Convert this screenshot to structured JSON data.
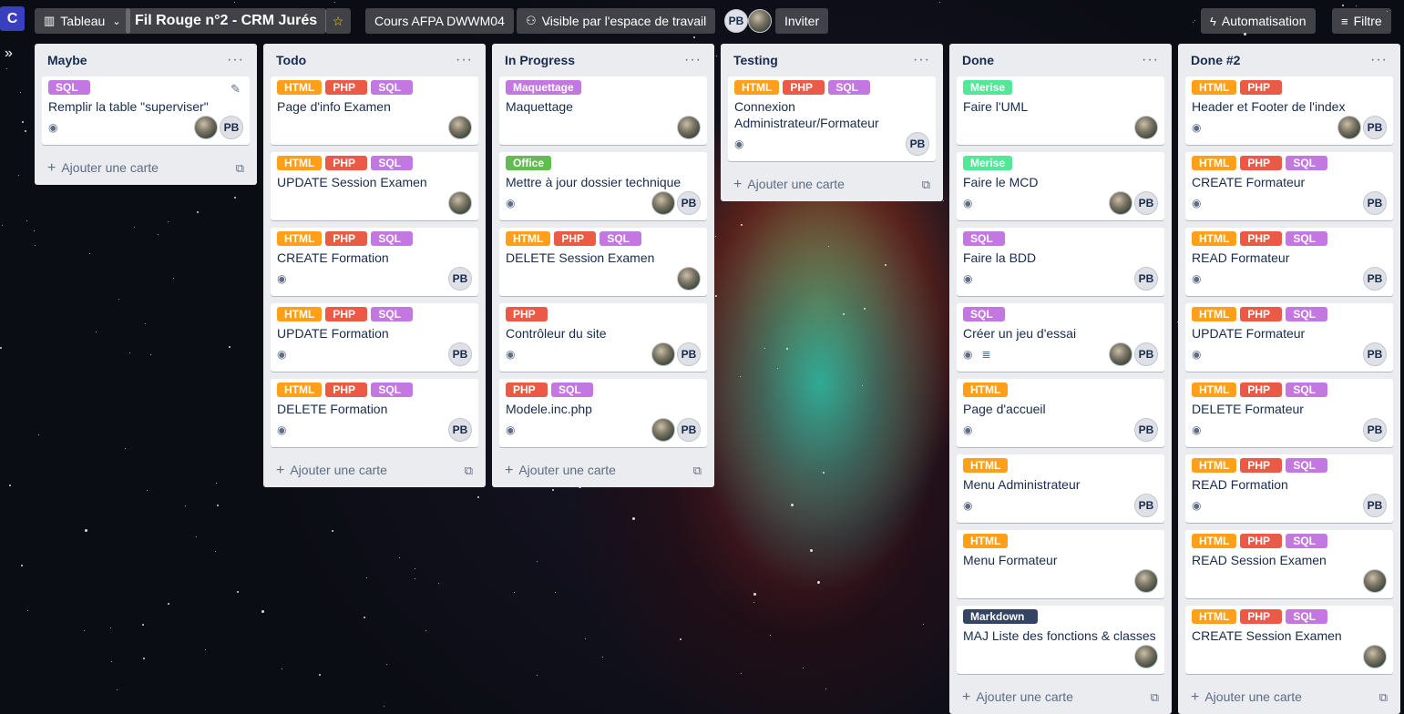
{
  "topbar": {
    "logo": "C",
    "view_label": "Tableau",
    "board_title": "Fil Rouge n°2 - CRM Jurés",
    "workspace": "Cours AFPA DWWM04",
    "visibility": "Visible par l'espace de travail",
    "member_initials": "PB",
    "invite": "Inviter",
    "automation": "Automatisation",
    "filter": "Filtre"
  },
  "colors": {
    "HTML": "#ff9f1a",
    "PHP": "#eb5a46",
    "SQL": "#c377e0",
    "Maquettage": "#c377e0",
    "Office": "#61bd4f",
    "Merise": "#51e898",
    "Markdown": "#344563"
  },
  "add_card_label": "Ajouter une carte",
  "lists": [
    {
      "title": "Maybe",
      "cards": [
        {
          "labels": [
            "SQL"
          ],
          "title": "Remplir la table \"superviser\"",
          "watch": true,
          "desc": false,
          "members": [
            "img",
            "PB"
          ],
          "edit": true
        }
      ]
    },
    {
      "title": "Todo",
      "cards": [
        {
          "labels": [
            "HTML",
            "PHP",
            "SQL"
          ],
          "title": "Page d'info Examen",
          "watch": false,
          "desc": false,
          "members": [
            "img"
          ]
        },
        {
          "labels": [
            "HTML",
            "PHP",
            "SQL"
          ],
          "title": "UPDATE Session Examen",
          "watch": false,
          "desc": false,
          "members": [
            "img"
          ]
        },
        {
          "labels": [
            "HTML",
            "PHP",
            "SQL"
          ],
          "title": "CREATE Formation",
          "watch": true,
          "desc": false,
          "members": [
            "PB"
          ]
        },
        {
          "labels": [
            "HTML",
            "PHP",
            "SQL"
          ],
          "title": "UPDATE Formation",
          "watch": true,
          "desc": false,
          "members": [
            "PB"
          ]
        },
        {
          "labels": [
            "HTML",
            "PHP",
            "SQL"
          ],
          "title": "DELETE Formation",
          "watch": true,
          "desc": false,
          "members": [
            "PB"
          ]
        }
      ]
    },
    {
      "title": "In Progress",
      "cards": [
        {
          "labels": [
            "Maquettage"
          ],
          "title": "Maquettage",
          "watch": false,
          "desc": false,
          "members": [
            "img"
          ]
        },
        {
          "labels": [
            "Office"
          ],
          "title": "Mettre à jour dossier technique",
          "watch": true,
          "desc": false,
          "members": [
            "img",
            "PB"
          ]
        },
        {
          "labels": [
            "HTML",
            "PHP",
            "SQL"
          ],
          "title": "DELETE Session Examen",
          "watch": false,
          "desc": false,
          "members": [
            "img"
          ]
        },
        {
          "labels": [
            "PHP"
          ],
          "title": "Contrôleur du site",
          "watch": true,
          "desc": false,
          "members": [
            "img",
            "PB"
          ]
        },
        {
          "labels": [
            "PHP",
            "SQL"
          ],
          "title": "Modele.inc.php",
          "watch": true,
          "desc": false,
          "members": [
            "img",
            "PB"
          ]
        }
      ]
    },
    {
      "title": "Testing",
      "cards": [
        {
          "labels": [
            "HTML",
            "PHP",
            "SQL"
          ],
          "title": "Connexion Administrateur/Formateur",
          "watch": true,
          "desc": false,
          "members": [
            "PB"
          ]
        }
      ]
    },
    {
      "title": "Done",
      "cards": [
        {
          "labels": [
            "Merise"
          ],
          "title": "Faire l'UML",
          "watch": false,
          "desc": false,
          "members": [
            "img"
          ]
        },
        {
          "labels": [
            "Merise"
          ],
          "title": "Faire le MCD",
          "watch": true,
          "desc": false,
          "members": [
            "img",
            "PB"
          ]
        },
        {
          "labels": [
            "SQL"
          ],
          "title": "Faire la BDD",
          "watch": true,
          "desc": false,
          "members": [
            "PB"
          ]
        },
        {
          "labels": [
            "SQL"
          ],
          "title": "Créer un jeu d'essai",
          "watch": true,
          "desc": true,
          "members": [
            "img",
            "PB"
          ]
        },
        {
          "labels": [
            "HTML"
          ],
          "title": "Page d'accueil",
          "watch": true,
          "desc": false,
          "members": [
            "PB"
          ]
        },
        {
          "labels": [
            "HTML"
          ],
          "title": "Menu Administrateur",
          "watch": true,
          "desc": false,
          "members": [
            "PB"
          ]
        },
        {
          "labels": [
            "HTML"
          ],
          "title": "Menu Formateur",
          "watch": false,
          "desc": false,
          "members": [
            "img"
          ]
        },
        {
          "labels": [
            "Markdown"
          ],
          "title": "MAJ Liste des fonctions & classes",
          "watch": false,
          "desc": false,
          "members": [
            "img"
          ]
        }
      ]
    },
    {
      "title": "Done #2",
      "cards": [
        {
          "labels": [
            "HTML",
            "PHP"
          ],
          "title": "Header et Footer de l'index",
          "watch": true,
          "desc": false,
          "members": [
            "img",
            "PB"
          ]
        },
        {
          "labels": [
            "HTML",
            "PHP",
            "SQL"
          ],
          "title": "CREATE Formateur",
          "watch": true,
          "desc": false,
          "members": [
            "PB"
          ]
        },
        {
          "labels": [
            "HTML",
            "PHP",
            "SQL"
          ],
          "title": "READ Formateur",
          "watch": true,
          "desc": false,
          "members": [
            "PB"
          ]
        },
        {
          "labels": [
            "HTML",
            "PHP",
            "SQL"
          ],
          "title": "UPDATE Formateur",
          "watch": true,
          "desc": false,
          "members": [
            "PB"
          ]
        },
        {
          "labels": [
            "HTML",
            "PHP",
            "SQL"
          ],
          "title": "DELETE Formateur",
          "watch": true,
          "desc": false,
          "members": [
            "PB"
          ]
        },
        {
          "labels": [
            "HTML",
            "PHP",
            "SQL"
          ],
          "title": "READ Formation",
          "watch": true,
          "desc": false,
          "members": [
            "PB"
          ]
        },
        {
          "labels": [
            "HTML",
            "PHP",
            "SQL"
          ],
          "title": "READ Session Examen",
          "watch": false,
          "desc": false,
          "members": [
            "img"
          ]
        },
        {
          "labels": [
            "HTML",
            "PHP",
            "SQL"
          ],
          "title": "CREATE Session Examen",
          "watch": false,
          "desc": false,
          "members": [
            "img"
          ]
        }
      ]
    }
  ]
}
